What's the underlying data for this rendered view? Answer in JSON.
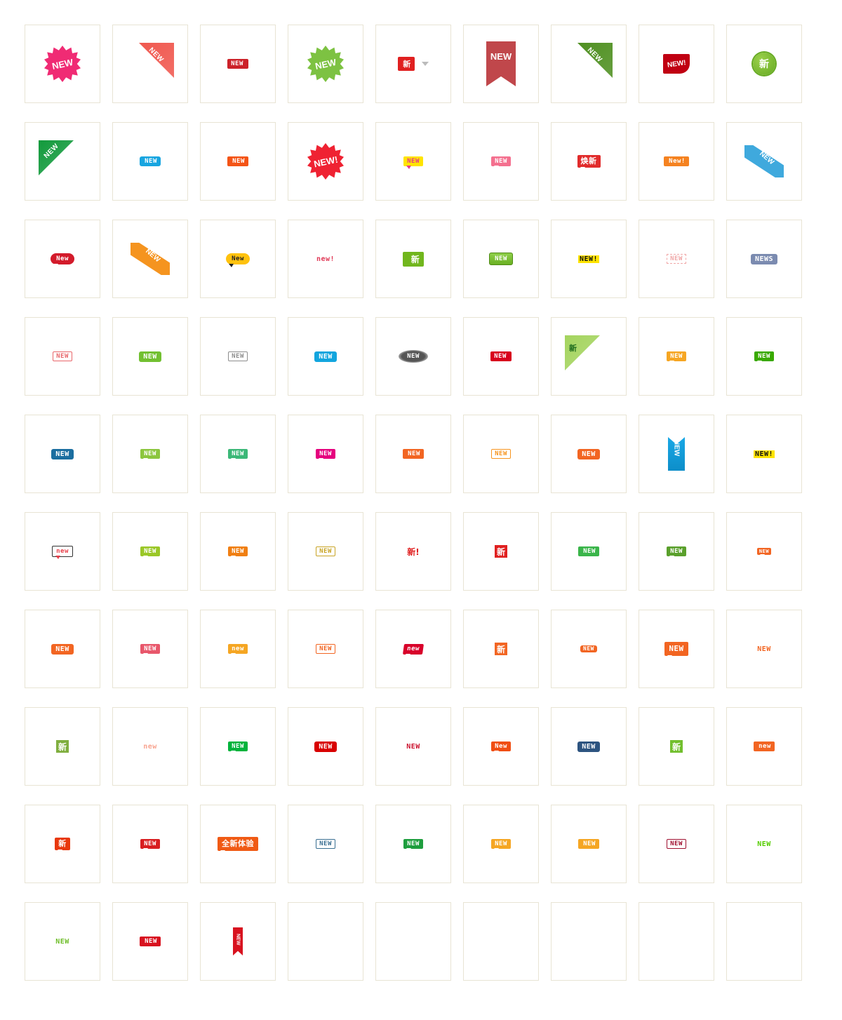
{
  "page": {
    "title": "NEW badge icon gallery",
    "grid": {
      "columns": 9,
      "rows": 10,
      "cell_count": 90,
      "filled_cells": 84,
      "empty_cells": 6
    },
    "cell_border_color": "#e8e4d4",
    "background": "#ffffff"
  },
  "items": [
    {
      "id": 1,
      "label": "NEW",
      "style": "starburst",
      "bg": "#f02b74",
      "fg": "#ffffff"
    },
    {
      "id": 2,
      "label": "NEW",
      "style": "corner-tr",
      "bg": "#f0584f",
      "fg": "#ffffff"
    },
    {
      "id": 3,
      "label": "NEW",
      "style": "arrow-right",
      "bg": "#cc2229",
      "fg": "#ffffff"
    },
    {
      "id": 4,
      "label": "NEW",
      "style": "starburst",
      "bg": "#7dc242",
      "fg": "#ffffff"
    },
    {
      "id": 5,
      "label": "新",
      "style": "arrow-left-cn",
      "bg": "#e02020",
      "fg": "#ffffff"
    },
    {
      "id": 6,
      "label": "NEW",
      "style": "bookmark-down",
      "bg": "#c0474b",
      "fg": "#ffffff"
    },
    {
      "id": 7,
      "label": "NEW",
      "style": "corner-tr",
      "bg": "#4f9021",
      "fg": "#ffffff"
    },
    {
      "id": 8,
      "label": "NEW!",
      "style": "leaf",
      "bg": "#c00012",
      "fg": "#ffffff"
    },
    {
      "id": 9,
      "label": "新",
      "style": "gear-circle",
      "bg": "#66aa22",
      "fg": "#ffffff"
    },
    {
      "id": 10,
      "label": "NEW",
      "style": "corner-tl",
      "bg": "#129a3c",
      "fg": "#ffffff"
    },
    {
      "id": 11,
      "label": "NEW",
      "style": "tag-left",
      "bg": "#18a5e0",
      "fg": "#ffffff"
    },
    {
      "id": 12,
      "label": "NEW",
      "style": "arrow-left",
      "bg": "#f45416",
      "fg": "#ffffff"
    },
    {
      "id": 13,
      "label": "NEW!",
      "style": "starburst",
      "bg": "#ef2232",
      "fg": "#ffffff"
    },
    {
      "id": 14,
      "label": "NEW",
      "style": "bubble",
      "bg": "#ffe400",
      "fg": "#e53b8a"
    },
    {
      "id": 15,
      "label": "NEW",
      "style": "bubble",
      "bg": "#f4708f",
      "fg": "#ffffff"
    },
    {
      "id": 16,
      "label": "焕新",
      "style": "bubble-cn",
      "bg": "#e12b2b",
      "fg": "#ffffff"
    },
    {
      "id": 17,
      "label": "New!",
      "style": "arrow-left",
      "bg": "#f58220",
      "fg": "#ffffff"
    },
    {
      "id": 18,
      "label": "NEW",
      "style": "corner-band",
      "bg": "#3fa9dd",
      "fg": "#ffffff"
    },
    {
      "id": 19,
      "label": "New",
      "style": "bubble-oval",
      "bg": "#d31b2b",
      "fg": "#ffffff"
    },
    {
      "id": 20,
      "label": "NEW",
      "style": "corner-band",
      "bg": "#f5941f",
      "fg": "#ffffff"
    },
    {
      "id": 21,
      "label": "New",
      "style": "bubble-oval",
      "bg": "#ffc20e",
      "fg": "#222222"
    },
    {
      "id": 22,
      "label": "new!",
      "style": "bare-text",
      "bg": "#ffffff",
      "fg": "#e03a57"
    },
    {
      "id": 23,
      "label": "新",
      "style": "arrow-right-cn",
      "bg": "#71b61d",
      "fg": "#ffffff"
    },
    {
      "id": 24,
      "label": "NEW",
      "style": "button-3d",
      "bg": "#6ab023",
      "fg": "#ffffff"
    },
    {
      "id": 25,
      "label": "NEW!",
      "style": "highlight",
      "bg": "#ffe400",
      "fg": "#111111"
    },
    {
      "id": 26,
      "label": "NEW",
      "style": "dashed-box",
      "bg": "#ffffff",
      "fg": "#f0a8a8"
    },
    {
      "id": 27,
      "label": "NEWS",
      "style": "pill",
      "bg": "#7b8bb0",
      "fg": "#ffffff"
    },
    {
      "id": 28,
      "label": "NEW",
      "style": "outline-tag",
      "bg": "#ffffff",
      "fg": "#e8676b"
    },
    {
      "id": 29,
      "label": "NEW",
      "style": "pill",
      "bg": "#72c031",
      "fg": "#ffffff"
    },
    {
      "id": 30,
      "label": "NEW",
      "style": "outline-tag",
      "bg": "#ffffff",
      "fg": "#8d8d8d"
    },
    {
      "id": 31,
      "label": "NEW",
      "style": "pill",
      "bg": "#12a5de",
      "fg": "#ffffff"
    },
    {
      "id": 32,
      "label": "NEW",
      "style": "cloud",
      "bg": "#555555",
      "fg": "#ffffff"
    },
    {
      "id": 33,
      "label": "NEW",
      "style": "arrow-right",
      "bg": "#d8001d",
      "fg": "#ffffff"
    },
    {
      "id": 34,
      "label": "新",
      "style": "corner-tl-cn",
      "bg": "#a4d45e",
      "fg": "#1d6b1d"
    },
    {
      "id": 35,
      "label": "NEW",
      "style": "bubble",
      "bg": "#f6a623",
      "fg": "#ffffff"
    },
    {
      "id": 36,
      "label": "NEW",
      "style": "bubble",
      "bg": "#39a900",
      "fg": "#ffffff"
    },
    {
      "id": 37,
      "label": "NEW",
      "style": "pill",
      "bg": "#1b6ea0",
      "fg": "#ffffff"
    },
    {
      "id": 38,
      "label": "NEW",
      "style": "bubble",
      "bg": "#8cc63e",
      "fg": "#ffffff"
    },
    {
      "id": 39,
      "label": "NEW",
      "style": "bubble",
      "bg": "#3cb878",
      "fg": "#ffffff"
    },
    {
      "id": 40,
      "label": "NEW",
      "style": "bubble",
      "bg": "#e5007e",
      "fg": "#ffffff"
    },
    {
      "id": 41,
      "label": "NEW",
      "style": "arrow-left",
      "bg": "#f26522",
      "fg": "#ffffff"
    },
    {
      "id": 42,
      "label": "NEW",
      "style": "outline-tag",
      "bg": "#ffffff",
      "fg": "#f7941e"
    },
    {
      "id": 43,
      "label": "NEW",
      "style": "pill",
      "bg": "#f26522",
      "fg": "#ffffff"
    },
    {
      "id": 44,
      "label": "NEW",
      "style": "bookmark-up",
      "bg": "#19a8e6",
      "fg": "#ffffff"
    },
    {
      "id": 45,
      "label": "NEW!",
      "style": "highlight",
      "bg": "#ffe400",
      "fg": "#111111"
    },
    {
      "id": 46,
      "label": "new",
      "style": "bubble-dark",
      "bg": "#ffffff",
      "fg": "#e8404a"
    },
    {
      "id": 47,
      "label": "NEW",
      "style": "bubble",
      "bg": "#9ac727",
      "fg": "#ffffff"
    },
    {
      "id": 48,
      "label": "NEW",
      "style": "bubble",
      "bg": "#f07f13",
      "fg": "#ffffff"
    },
    {
      "id": 49,
      "label": "NEW",
      "style": "outline-tag",
      "bg": "#ffffff",
      "fg": "#c8a425"
    },
    {
      "id": 50,
      "label": "新!",
      "style": "bare-text-cn",
      "bg": "#ffffff",
      "fg": "#e02020"
    },
    {
      "id": 51,
      "label": "新",
      "style": "square-cn",
      "bg": "#e02020",
      "fg": "#ffffff"
    },
    {
      "id": 52,
      "label": "NEW",
      "style": "arrow-left",
      "bg": "#3ab54a",
      "fg": "#ffffff"
    },
    {
      "id": 53,
      "label": "NEW",
      "style": "bubble",
      "bg": "#5aa02c",
      "fg": "#ffffff"
    },
    {
      "id": 54,
      "label": "NEW",
      "style": "bubble-tiny",
      "bg": "#f26522",
      "fg": "#ffffff"
    },
    {
      "id": 55,
      "label": "NEW",
      "style": "pill",
      "bg": "#f26522",
      "fg": "#ffffff"
    },
    {
      "id": 56,
      "label": "NEW",
      "style": "bubble",
      "bg": "#e8576b",
      "fg": "#ffffff"
    },
    {
      "id": 57,
      "label": "new",
      "style": "bubble",
      "bg": "#f5a623",
      "fg": "#ffffff"
    },
    {
      "id": 58,
      "label": "NEW",
      "style": "outline-tag",
      "bg": "#ffffff",
      "fg": "#f26522"
    },
    {
      "id": 59,
      "label": "new",
      "style": "bubble-slant",
      "bg": "#d8002a",
      "fg": "#ffffff"
    },
    {
      "id": 60,
      "label": "新",
      "style": "square-cn",
      "bg": "#f26522",
      "fg": "#ffffff"
    },
    {
      "id": 61,
      "label": "NEW",
      "style": "pill-tiny",
      "bg": "#f26522",
      "fg": "#ffffff"
    },
    {
      "id": 62,
      "label": "NEW",
      "style": "bubble-bold",
      "bg": "#f26522",
      "fg": "#ffffff"
    },
    {
      "id": 63,
      "label": "NEW",
      "style": "bare-text",
      "bg": "#ffffff",
      "fg": "#f26522"
    },
    {
      "id": 64,
      "label": "新",
      "style": "square-cn",
      "bg": "#7fae3e",
      "fg": "#ffffff"
    },
    {
      "id": 65,
      "label": "new",
      "style": "bare-text",
      "bg": "#ffffff",
      "fg": "#f8a490"
    },
    {
      "id": 66,
      "label": "NEW",
      "style": "bubble",
      "bg": "#00b33c",
      "fg": "#ffffff"
    },
    {
      "id": 67,
      "label": "NEW",
      "style": "pill",
      "bg": "#d80000",
      "fg": "#ffffff"
    },
    {
      "id": 68,
      "label": "NEW",
      "style": "bare-text",
      "bg": "#ffffff",
      "fg": "#cc1430"
    },
    {
      "id": 69,
      "label": "New",
      "style": "bubble",
      "bg": "#f04e13",
      "fg": "#ffffff"
    },
    {
      "id": 70,
      "label": "NEW",
      "style": "pill",
      "bg": "#2d5480",
      "fg": "#ffffff"
    },
    {
      "id": 71,
      "label": "新",
      "style": "square-cn",
      "bg": "#72bf2e",
      "fg": "#ffffff"
    },
    {
      "id": 72,
      "label": "new",
      "style": "arrow-left",
      "bg": "#f26522",
      "fg": "#ffffff"
    },
    {
      "id": 73,
      "label": "新",
      "style": "bubble-cn",
      "bg": "#e8380d",
      "fg": "#ffffff"
    },
    {
      "id": 74,
      "label": "NEW",
      "style": "bubble",
      "bg": "#d81e20",
      "fg": "#ffffff"
    },
    {
      "id": 75,
      "label": "全新体验",
      "style": "bubble-cn-wide",
      "bg": "#f05a14",
      "fg": "#ffffff"
    },
    {
      "id": 76,
      "label": "NEW",
      "style": "outline-tag",
      "bg": "#ffffff",
      "fg": "#3a6f92"
    },
    {
      "id": 77,
      "label": "NEW",
      "style": "bubble",
      "bg": "#1e9e3e",
      "fg": "#ffffff"
    },
    {
      "id": 78,
      "label": "NEW",
      "style": "bubble",
      "bg": "#f5a623",
      "fg": "#ffffff"
    },
    {
      "id": 79,
      "label": "NEW",
      "style": "arrow-left",
      "bg": "#f5a623",
      "fg": "#ffffff"
    },
    {
      "id": 80,
      "label": "NEW",
      "style": "outline-tag",
      "bg": "#ffffff",
      "fg": "#a01030"
    },
    {
      "id": 81,
      "label": "NEW",
      "style": "bare-text",
      "bg": "#ffffff",
      "fg": "#55cc00"
    },
    {
      "id": 82,
      "label": "NEW",
      "style": "bare-text",
      "bg": "#ffffff",
      "fg": "#6fbe2a"
    },
    {
      "id": 83,
      "label": "NEW",
      "style": "arrow-left",
      "bg": "#d8121f",
      "fg": "#ffffff"
    },
    {
      "id": 84,
      "label": "NEW",
      "style": "ribbon-vertical",
      "bg": "#d8121f",
      "fg": "#ffffff"
    },
    {
      "id": 85,
      "label": "",
      "style": "empty",
      "bg": "#ffffff",
      "fg": "#ffffff"
    },
    {
      "id": 86,
      "label": "",
      "style": "empty",
      "bg": "#ffffff",
      "fg": "#ffffff"
    },
    {
      "id": 87,
      "label": "",
      "style": "empty",
      "bg": "#ffffff",
      "fg": "#ffffff"
    },
    {
      "id": 88,
      "label": "",
      "style": "empty",
      "bg": "#ffffff",
      "fg": "#ffffff"
    },
    {
      "id": 89,
      "label": "",
      "style": "empty",
      "bg": "#ffffff",
      "fg": "#ffffff"
    },
    {
      "id": 90,
      "label": "",
      "style": "empty",
      "bg": "#ffffff",
      "fg": "#ffffff"
    }
  ]
}
